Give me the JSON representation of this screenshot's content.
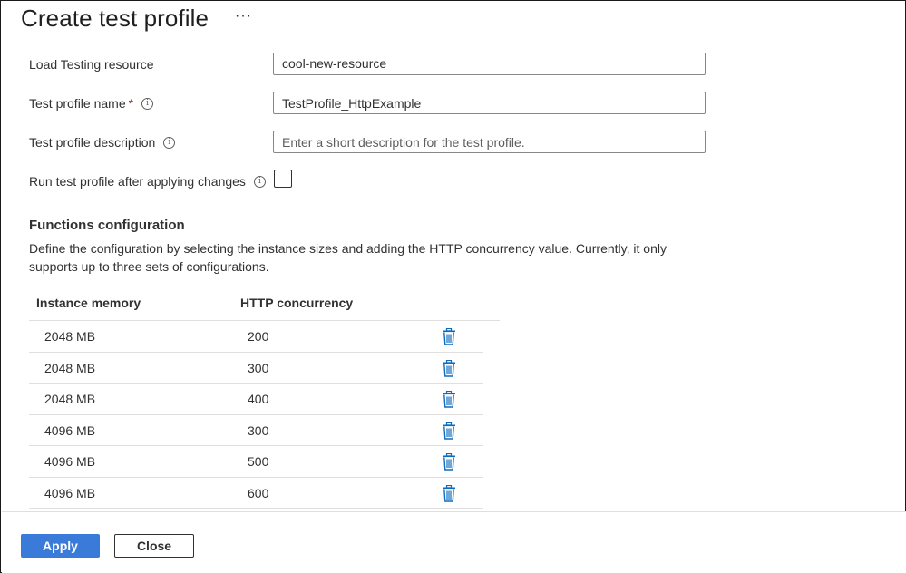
{
  "header": {
    "title": "Create test profile",
    "more_label": "···"
  },
  "form": {
    "resource": {
      "label": "Load Testing resource",
      "value": "cool-new-resource"
    },
    "name": {
      "label": "Test profile name",
      "required_mark": "*",
      "value": "TestProfile_HttpExample"
    },
    "description": {
      "label": "Test profile description",
      "value": "",
      "placeholder": "Enter a short description for the test profile."
    },
    "run_after": {
      "label": "Run test profile after applying changes",
      "checked": false
    },
    "info_glyph": "i"
  },
  "functions": {
    "title": "Functions configuration",
    "description": "Define the configuration by selecting the instance sizes and adding the HTTP concurrency value. Currently, it only supports up to three sets of configurations.",
    "columns": {
      "memory": "Instance memory",
      "concurrency": "HTTP concurrency"
    },
    "rows": [
      {
        "memory": "2048 MB",
        "concurrency": "200"
      },
      {
        "memory": "2048 MB",
        "concurrency": "300"
      },
      {
        "memory": "2048 MB",
        "concurrency": "400"
      },
      {
        "memory": "4096 MB",
        "concurrency": "300"
      },
      {
        "memory": "4096 MB",
        "concurrency": "500"
      },
      {
        "memory": "4096 MB",
        "concurrency": "600"
      }
    ],
    "delete_icon": "trash-icon",
    "accent_color": "#0f6cbd"
  },
  "footer": {
    "apply_label": "Apply",
    "close_label": "Close",
    "primary_color": "#3a7ad8"
  }
}
